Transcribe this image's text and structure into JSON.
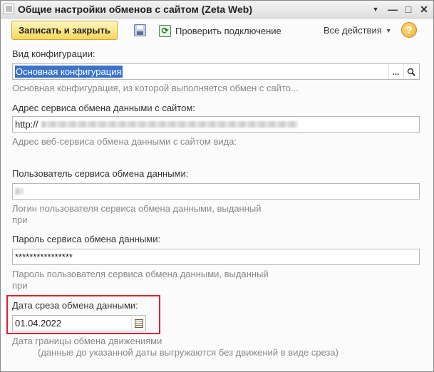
{
  "window": {
    "title": "Общие настройки обменов с сайтом (Zeta Web)",
    "controls": {
      "menu": "▼",
      "minimize": "—",
      "maximize": "□",
      "close": "✕"
    }
  },
  "toolbar": {
    "save_close_label": "Записать и закрыть",
    "check_connection_label": "Проверить подключение",
    "all_actions_label": "Все действия",
    "help_label": "?"
  },
  "form": {
    "configuration": {
      "label": "Вид конфигурации:",
      "value": "Основная конфигурация",
      "hint": "Основная конфигурация, из которой выполняется обмен с сайто...",
      "button_select": "...",
      "button_open_icon": "magnifier-icon"
    },
    "service_address": {
      "label": "Адрес сервиса обмена данными с сайтом:",
      "value": "http://",
      "hint": "Адрес веб-сервиса обмена данными с сайтом вида:"
    },
    "service_user": {
      "label": "Пользователь сервиса обмена данными:",
      "hint_line1": "Логин пользователя сервиса обмена данными, выданный",
      "hint_line2": "при"
    },
    "service_password": {
      "label": "Пароль сервиса обмена данными:",
      "value": "****************",
      "hint_line1": "Пароль пользователя сервиса обмена данными, выданный",
      "hint_line2": "при"
    },
    "cutoff_date": {
      "label": "Дата среза обмена данными:",
      "value": "01.04.2022",
      "hint_line1": "Дата границы обмена движениями",
      "hint_line2": "(данные до указанной даты выгружаются без движений в виде среза)"
    }
  },
  "colors": {
    "highlight_border": "#d9232f",
    "selection": "#3b74c9",
    "save_button": "#f7d65a"
  }
}
